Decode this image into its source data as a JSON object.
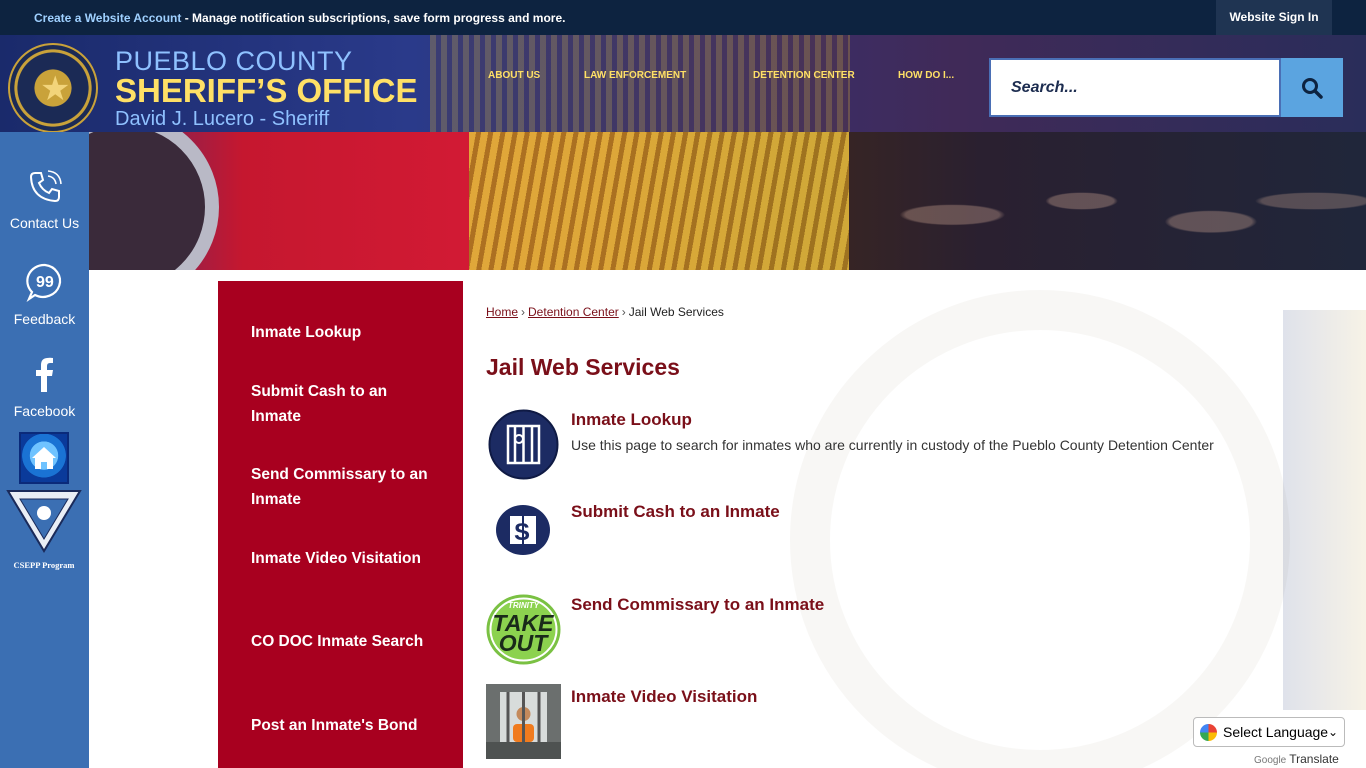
{
  "topbar": {
    "create_account_link": "Create a Website Account",
    "message": " - Manage notification subscriptions, save form progress and more.",
    "sign_in": "Website Sign In"
  },
  "header": {
    "brand_line1": "PUEBLO COUNTY",
    "brand_line2": "SHERIFF’S OFFICE",
    "brand_line3": "David J. Lucero - Sheriff",
    "nav": [
      "ABOUT US",
      "LAW ENFORCEMENT",
      "DETENTION CENTER",
      "HOW DO I..."
    ],
    "search_placeholder": "Search..."
  },
  "quickbar": {
    "items": [
      "Contact Us",
      "Feedback",
      "Facebook"
    ],
    "csepp_label": "CSEPP Program"
  },
  "sidenav": [
    "Inmate Lookup",
    "Submit Cash to an Inmate",
    "Send Commissary to an Inmate",
    "Inmate Video Visitation",
    "CO DOC Inmate Search",
    "Post an Inmate's Bond"
  ],
  "breadcrumb": {
    "home": "Home",
    "parent": "Detention Center",
    "current": "Jail Web Services"
  },
  "main": {
    "title": "Jail Web Services",
    "entries": [
      {
        "title": "Inmate Lookup",
        "desc": "Use this page to search for inmates who are currently in custody of the Pueblo County Detention Center"
      },
      {
        "title": "Submit Cash to an Inmate"
      },
      {
        "title": "Send Commissary to an Inmate"
      },
      {
        "title": "Inmate Video Visitation"
      }
    ],
    "takeout_brand": "TRINITY",
    "takeout_text": "TAKE OUT"
  },
  "translate": {
    "select_label": "Select Language",
    "powered_google": "Google",
    "powered_translate": "Translate"
  },
  "colors": {
    "primary_red": "#a8001f",
    "title_red": "#7a0f19",
    "topbar_navy": "#0d2340",
    "quickbar_blue": "#3b6fb3",
    "accent_yellow": "#ffe066"
  }
}
